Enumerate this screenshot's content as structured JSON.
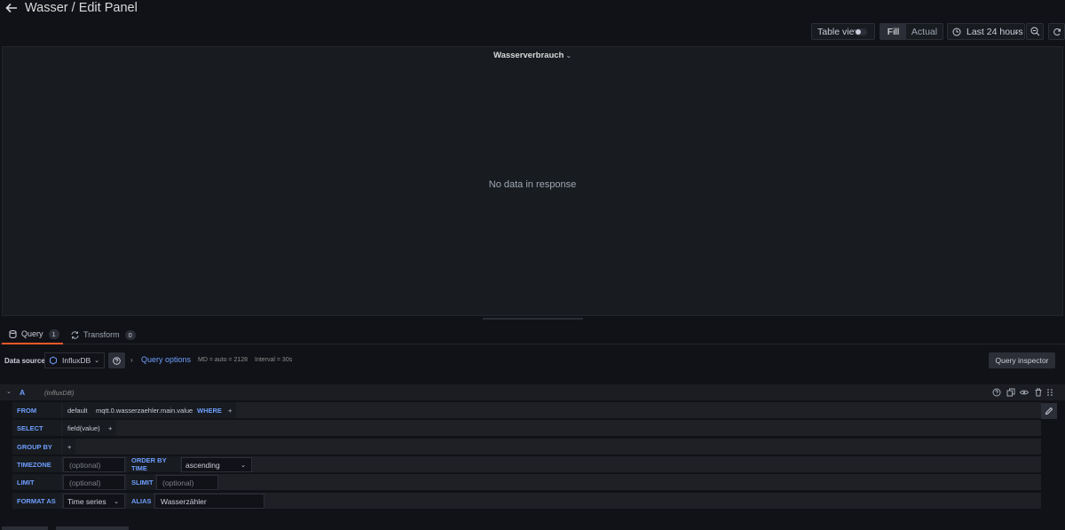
{
  "header": {
    "title": "Wasser / Edit Panel"
  },
  "toolbar": {
    "table_view_label": "Table view",
    "fill_label": "Fill",
    "actual_label": "Actual",
    "time_range_label": "Last 24 hours"
  },
  "panel": {
    "title": "Wasserverbrauch",
    "no_data": "No data in response"
  },
  "tabs": [
    {
      "label": "Query",
      "count": "1"
    },
    {
      "label": "Transform",
      "count": "0"
    }
  ],
  "query_bar": {
    "ds_label": "Data source",
    "ds_value": "InfluxDB",
    "query_options": "Query options",
    "md": "MD = auto = 2128",
    "interval": "Interval = 30s",
    "inspector": "Query inspector"
  },
  "query_a": {
    "letter": "A",
    "source": "(InfluxDB)",
    "from_kw": "FROM",
    "from_policy": "default",
    "from_measurement": "mqtt.0.wasserzaehler.main.value",
    "where_kw": "WHERE",
    "plus": "+",
    "select_kw": "SELECT",
    "select_field": "field(value)",
    "groupby_kw": "GROUP BY",
    "timezone_kw": "TIMEZONE",
    "timezone_ph": "(optional)",
    "orderby_kw": "ORDER BY TIME",
    "orderby_value": "ascending",
    "limit_kw": "LIMIT",
    "limit_ph": "(optional)",
    "slimit_kw": "SLIMIT",
    "slimit_ph": "(optional)",
    "format_kw": "FORMAT AS",
    "format_value": "Time series",
    "alias_kw": "ALIAS",
    "alias_value": "Wasserzähler"
  },
  "colors": {
    "accent": "#6e9fff",
    "tab_active": "#f05a28",
    "bg": "#111217",
    "panel_bg": "#181b1f"
  }
}
